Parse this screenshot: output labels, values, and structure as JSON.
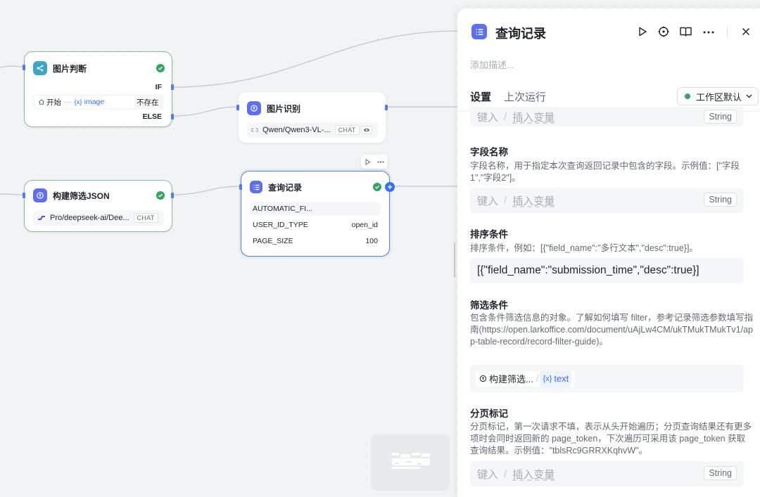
{
  "nodes": {
    "image_judge": {
      "title": "图片判断",
      "cond_start": "开始",
      "cond_dots": "···",
      "cond_var_prefix": "{x}",
      "cond_var": "image",
      "cond_op": "不存在",
      "branch_if": "IF",
      "branch_else": "ELSE"
    },
    "build_filter": {
      "title": "构建筛选JSON",
      "model": "Pro/deepseek-ai/Dee...",
      "model_tag": "CHAT"
    },
    "image_recog": {
      "title": "图片识别",
      "model": "Qwen/Qwen3-VL-...",
      "model_tag": "CHAT"
    },
    "query_record": {
      "title": "查询记录",
      "rows": [
        {
          "key": "AUTOMATIC_FI...",
          "value": ""
        },
        {
          "key": "USER_ID_TYPE",
          "value": "open_id"
        },
        {
          "key": "PAGE_SIZE",
          "value": "100"
        }
      ]
    }
  },
  "panel": {
    "title": "查询记录",
    "desc_placeholder": "添加描述...",
    "tabs": [
      {
        "label": "设置",
        "active": true
      },
      {
        "label": "上次运行",
        "active": false
      }
    ],
    "workspace": "工作区默认",
    "placeholder_input": "键入",
    "placeholder_slash": "/",
    "placeholder_insert": "插入变量",
    "type_string": "String",
    "sections": [
      {
        "label": "字段名称",
        "desc": "字段名称，用于指定本次查询返回记录中包含的字段。示例值：[\"字段1\",\"字段2\"]。"
      },
      {
        "label": "排序条件",
        "desc": "排序条件，例如：[{\"field_name\":\"多行文本\",\"desc\":true}]。",
        "value": "[{\"field_name\":\"submission_time\",\"desc\":true}]"
      },
      {
        "label": "筛选条件",
        "desc": "包含条件筛选信息的对象。了解如何填写 filter，参考记录筛选参数填写指南(https://open.larkoffice.com/document/uAjLw4CM/ukTMukTMukTv1/app-table-record/record-filter-guide)。",
        "var_node": "构建筛选...",
        "var_prefix": "{x}",
        "var_name": "text"
      },
      {
        "label": "分页标记",
        "desc": "分页标记，第一次请求不填，表示从头开始遍历；分页查询结果还有更多项时会同时返回新的 page_token，下次遍历可采用该 page_token 获取查询结果。示例值：\"tblsRc9GRRXKqhvW\"。"
      }
    ]
  },
  "colors": {
    "accent_blue": "#4d7cf5",
    "success_green": "#2fa763",
    "node_icon_teal": "#3aa6c9",
    "node_icon_indigo": "#5b6ef5"
  }
}
